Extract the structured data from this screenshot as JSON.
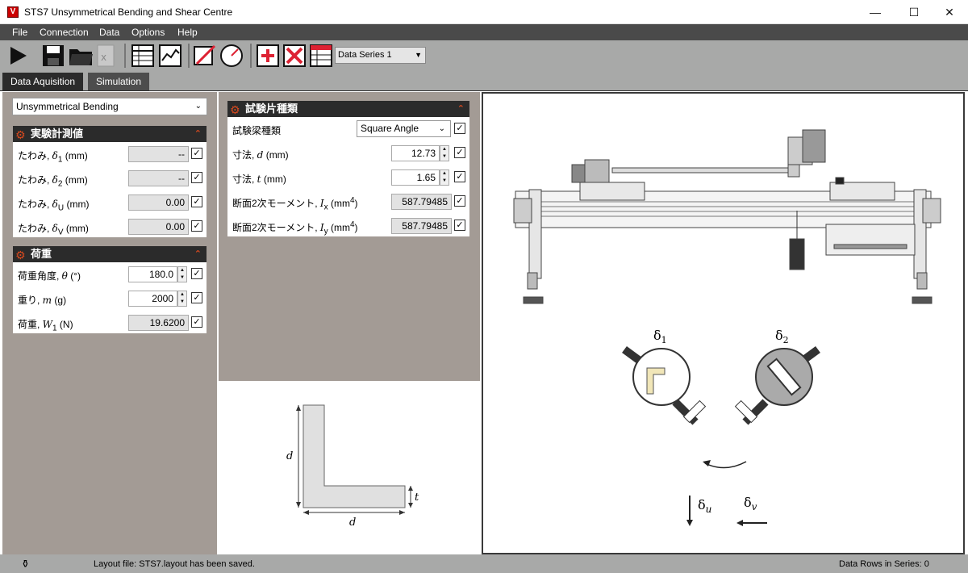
{
  "window": {
    "title": "STS7 Unsymmetrical Bending and Shear Centre",
    "app_icon_letter": "V",
    "minimize": "—",
    "maximize": "☐",
    "close": "✕"
  },
  "menu": [
    "File",
    "Connection",
    "Data",
    "Options",
    "Help"
  ],
  "toolbar": {
    "series_selected": "Data Series 1",
    "icons": [
      "play-icon",
      "save-icon",
      "open-folder-icon",
      "excel-export-icon",
      "table-view-icon",
      "chart-view-icon",
      "edit-tool-icon",
      "gauge-icon",
      "add-row-icon",
      "delete-row-icon",
      "table-edit-icon"
    ]
  },
  "tabs": [
    "Data Aquisition",
    "Simulation"
  ],
  "mode_select": "Unsymmetrical Bending",
  "measurements": {
    "title": "実験計測値",
    "rows": [
      {
        "label_pre": "たわみ, ",
        "sym": "δ",
        "sub": "1",
        "unit": " (mm)",
        "value": "--"
      },
      {
        "label_pre": "たわみ, ",
        "sym": "δ",
        "sub": "2",
        "unit": " (mm)",
        "value": "--"
      },
      {
        "label_pre": "たわみ, ",
        "sym": "δ",
        "sub": "U",
        "unit": " (mm)",
        "value": "0.00"
      },
      {
        "label_pre": "たわみ, ",
        "sym": "δ",
        "sub": "V",
        "unit": " (mm)",
        "value": "0.00"
      }
    ]
  },
  "load": {
    "title": "荷重",
    "rows": [
      {
        "label_pre": "荷重角度, ",
        "sym": "θ",
        "sub": "",
        "unit": " (°)",
        "value": "180.0"
      },
      {
        "label_pre": "重り, ",
        "sym": "m",
        "sub": "",
        "unit": " (g)",
        "value": "2000"
      },
      {
        "label_pre": "荷重, ",
        "sym": "W",
        "sub": "1",
        "unit": " (N)",
        "value": "19.6200"
      }
    ]
  },
  "specimen": {
    "title": "試験片種類",
    "beam_type_label": "試験梁種類",
    "beam_type_value": "Square Angle",
    "rows": [
      {
        "label_pre": "寸法, ",
        "sym": "d",
        "sub": "",
        "unit": " (mm)",
        "value": "12.73"
      },
      {
        "label_pre": "寸法, ",
        "sym": "t",
        "sub": "",
        "unit": " (mm)",
        "value": "1.65"
      },
      {
        "label_pre": "断面2次モーメント, ",
        "sym": "I",
        "sub": "x",
        "unit": " (mm",
        "sup": "4",
        "unit_end": ")",
        "value": "587.79485"
      },
      {
        "label_pre": "断面2次モーメント, ",
        "sym": "I",
        "sub": "y",
        "unit": " (mm",
        "sup": "4",
        "unit_end": ")",
        "value": "587.79485"
      }
    ]
  },
  "section_diagram": {
    "dim_d": "d",
    "dim_t": "t"
  },
  "rig_diagram": {
    "gauge1_label": "δ",
    "gauge1_sub": "1",
    "gauge2_label": "δ",
    "gauge2_sub": "2",
    "du_label": "δ",
    "du_sub": "u",
    "dv_label": "δ",
    "dv_sub": "v"
  },
  "status": {
    "message": "Layout file: STS7.layout has been saved.",
    "rows": "Data Rows in Series: 0"
  }
}
